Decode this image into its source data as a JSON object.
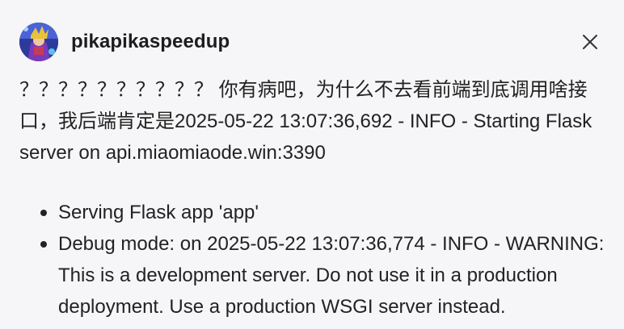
{
  "post": {
    "username": "pikapikaspeedup",
    "paragraph": "？？？？？？？？？？ 你有病吧，为什么不去看前端到底调用啥接口，我后端肯定是2025-05-22 13:07:36,692 - INFO - Starting Flask server on api.miaomiaode.win:3390",
    "bullets": [
      "Serving Flask app 'app'",
      "Debug mode: on 2025-05-22 13:07:36,774 - INFO - WARNING: This is a development server. Do not use it in a production deployment. Use a production WSGI server instead."
    ]
  },
  "icons": {
    "avatar": "user-avatar",
    "close": "close-icon"
  }
}
